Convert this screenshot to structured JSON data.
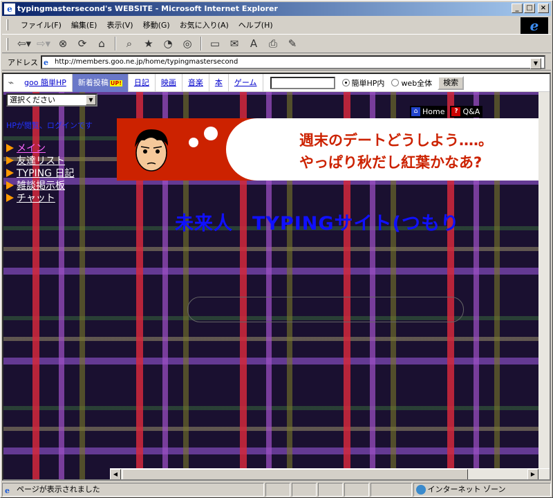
{
  "window": {
    "title": "typingmastersecond's WEBSITE - Microsoft Internet Explorer",
    "app_icon": "ie-page-icon",
    "controls": [
      "_",
      "□",
      "×"
    ]
  },
  "menubar": {
    "items": [
      "ファイル(F)",
      "編集(E)",
      "表示(V)",
      "移動(G)",
      "お気に入り(A)",
      "ヘルプ(H)"
    ]
  },
  "toolbar": {
    "icons": [
      "back-icon",
      "forward-icon",
      "stop-icon",
      "refresh-icon",
      "home-icon",
      "search-icon",
      "favorites-icon",
      "history-icon",
      "channels-icon",
      "fullscreen-icon",
      "mail-icon",
      "font-icon",
      "print-icon",
      "edit-icon"
    ]
  },
  "address": {
    "label": "アドレス",
    "url": "http://members.goo.ne.jp/home/typingmastersecond"
  },
  "goo_bar": {
    "links": [
      "goo 簡単HP",
      "新着投稿",
      "日記",
      "映画",
      "音楽",
      "本",
      "ゲーム"
    ],
    "up_badge": "UP!",
    "radio_options": [
      "簡単HP内",
      "web全体"
    ],
    "search_button": "検索"
  },
  "page": {
    "select_value": "選択ください",
    "hp_notice": "HPが閲覧、ログインです",
    "nav_items": [
      "メイン",
      "友達リスト",
      "TYPING 日記",
      "雑談掲示板",
      "チャット"
    ],
    "home_links": [
      "Home",
      "Q&A"
    ],
    "banner_line1": "週末のデートどうしよう‥‥。",
    "banner_line2": "やっぱり秋だし紅葉かなあ?",
    "site_title": "未来人　TYPINGサイト(つもり"
  },
  "statusbar": {
    "message": "ページが表示されました",
    "zone": "インターネット ゾーン"
  },
  "colors": {
    "title_gradient_start": "#0a246a",
    "title_gradient_end": "#a6caf0",
    "banner_red": "#cc2200",
    "site_title_blue": "#1010ff",
    "nav_arrow": "#ff9900"
  }
}
